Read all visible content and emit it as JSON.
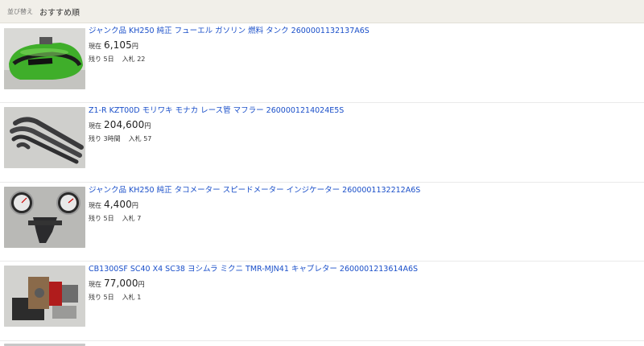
{
  "sort": {
    "label": "並び替え",
    "value": "おすすめ順"
  },
  "common": {
    "price_label": "現在",
    "currency": "円",
    "remaining_label": "残り",
    "bids_label": "入札"
  },
  "listings": [
    {
      "title": "ジャンク品 KH250 純正 フューエル ガソリン 燃料 タンク 2600001132137A6S",
      "price": "6,105",
      "remaining": "5日",
      "bids": "22"
    },
    {
      "title": "Z1-R KZT00D モリワキ モナカ レース管 マフラー 2600001214024E5S",
      "price": "204,600",
      "remaining": "3時間",
      "bids": "57"
    },
    {
      "title": "ジャンク品 KH250 純正 タコメーター スピードメーター インジケーター 2600001132212A6S",
      "price": "4,400",
      "remaining": "5日",
      "bids": "7"
    },
    {
      "title": "CB1300SF SC40 X4 SC38 ヨシムラ ミクニ TMR-MJN41 キャブレター 2600001213614A6S",
      "price": "77,000",
      "remaining": "5日",
      "bids": "1"
    }
  ]
}
